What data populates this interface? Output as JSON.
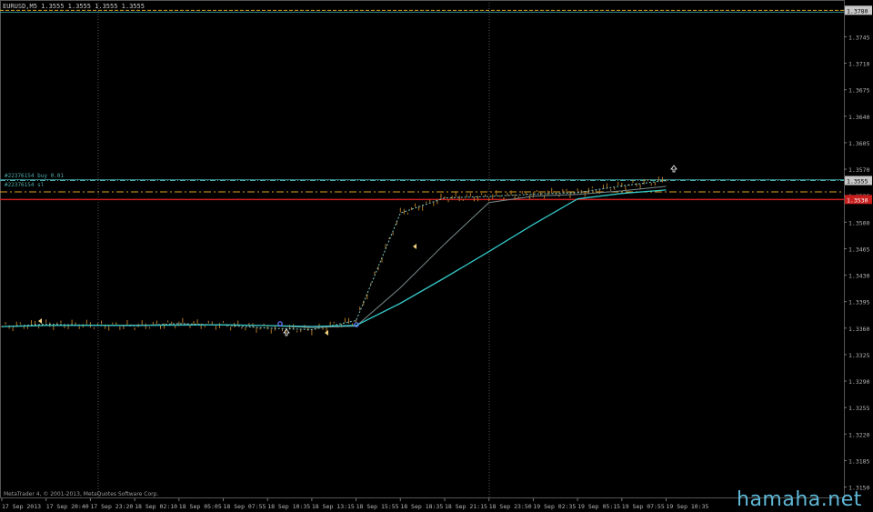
{
  "app": {
    "header": "EURUSD,M5  1.3555 1.3555 1.3555 1.3555",
    "copyright": "MetaTrader 4, © 2001-2013, MetaQuotes Software Corp.",
    "watermark": "hamaha.net"
  },
  "orders": {
    "buy_label": "#22376154 buy 0.01",
    "sl_label": "#22376154 sl"
  },
  "price_axis": {
    "ticks": [
      "1.3780",
      "1.3745",
      "1.3710",
      "1.3675",
      "1.3640",
      "1.3605",
      "1.3570",
      "1.3535",
      "1.3500",
      "1.3465",
      "1.3430",
      "1.3395",
      "1.3360",
      "1.3325",
      "1.3290",
      "1.3255",
      "1.3220",
      "1.3185",
      "1.3150"
    ],
    "top_marker": "1.3780",
    "bid_marker": "1.3555",
    "sl_marker": "1.3530"
  },
  "time_axis": {
    "labels": [
      "17 Sep 2013",
      "17 Sep 20:40",
      "17 Sep 23:20",
      "18 Sep 02:10",
      "18 Sep 05:05",
      "18 Sep 07:55",
      "18 Sep 10:35",
      "18 Sep 13:15",
      "18 Sep 15:55",
      "18 Sep 18:35",
      "18 Sep 21:15",
      "18 Sep 23:50",
      "19 Sep 02:35",
      "19 Sep 05:15",
      "19 Sep 07:55",
      "19 Sep 10:35"
    ]
  },
  "colors": {
    "background": "#000000",
    "grid": "#3a3a3a",
    "axis_text": "#b4b4b4",
    "candle": "#b07828",
    "ma_cyan": "#36c6c6",
    "ma_dashed": "#7fc8c8",
    "ma_grey": "#7a8a8a",
    "order_line": "#4fa8a8",
    "sl_line": "#c81e1e",
    "tp_line": "#e0a020",
    "watermark": "#5fb7d6"
  },
  "chart_data": {
    "type": "line",
    "symbol": "EURUSD",
    "timeframe": "M5",
    "ylim": [
      1.3135,
      1.379
    ],
    "x": [
      "17 Sep 2013",
      "17 Sep 20:40",
      "17 Sep 23:20",
      "18 Sep 02:10",
      "18 Sep 05:05",
      "18 Sep 07:55",
      "18 Sep 10:35",
      "18 Sep 13:15",
      "18 Sep 15:55",
      "18 Sep 18:35",
      "18 Sep 21:15",
      "18 Sep 23:50",
      "19 Sep 02:35",
      "19 Sep 05:15",
      "19 Sep 07:55",
      "19 Sep 10:35"
    ],
    "series": [
      {
        "values": [
          1.3362,
          1.3365,
          1.3364,
          1.3363,
          1.3366,
          1.3364,
          1.336,
          1.3358,
          1.337,
          1.3512,
          1.3532,
          1.3534,
          1.3537,
          1.3539,
          1.3548,
          1.3555
        ]
      }
    ],
    "levels": {
      "buy": 1.3555,
      "sl": 1.353,
      "tp": 1.354,
      "top": 1.378
    },
    "grid": true
  }
}
